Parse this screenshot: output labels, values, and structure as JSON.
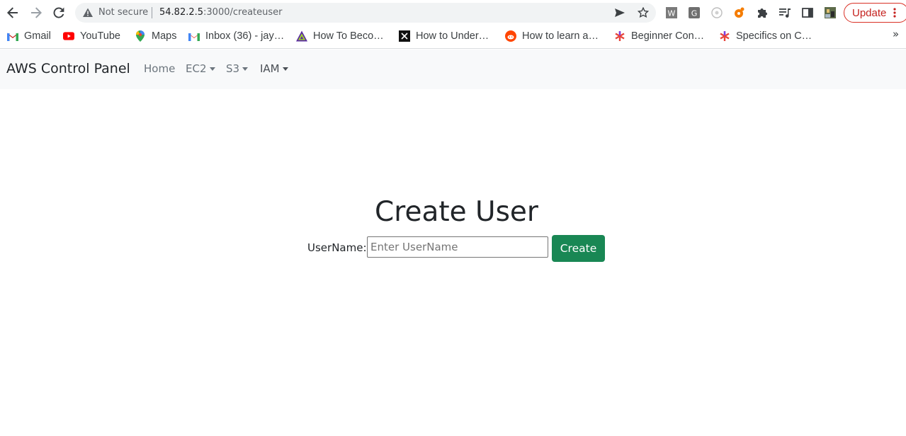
{
  "browser": {
    "security_label": "Not secure",
    "url_host": "54.82.2.5",
    "url_path": ":3000/createuser",
    "update_label": "Update",
    "accent_color": "#d93025",
    "icons": [
      "back-icon",
      "forward-icon",
      "reload-icon",
      "warning-icon",
      "send-icon",
      "star-icon",
      "extension-w-icon",
      "extension-g-icon",
      "extension-circle-icon",
      "extension-orange-icon",
      "puzzle-icon",
      "media-icon",
      "sidepanel-icon",
      "profile-icon",
      "more-icon"
    ]
  },
  "bookmarks": {
    "items": [
      {
        "label": "Gmail",
        "icon": "gmail-icon"
      },
      {
        "label": "YouTube",
        "icon": "youtube-icon"
      },
      {
        "label": "Maps",
        "icon": "maps-icon"
      },
      {
        "label": "Inbox (36) - jay…",
        "icon": "gmail-icon"
      },
      {
        "label": "How To Beco…",
        "icon": "triangle-icon"
      },
      {
        "label": "How to Under…",
        "icon": "square-logo-icon"
      },
      {
        "label": "How to learn a…",
        "icon": "reddit-icon"
      },
      {
        "label": "Beginner Con…",
        "icon": "asterisk-icon"
      },
      {
        "label": "Specifics on C…",
        "icon": "asterisk-icon"
      }
    ],
    "more": "»"
  },
  "navbar": {
    "brand": "AWS Control Panel",
    "links": [
      {
        "label": "Home",
        "dropdown": false
      },
      {
        "label": "EC2",
        "dropdown": true
      },
      {
        "label": "S3",
        "dropdown": true
      },
      {
        "label": "IAM",
        "dropdown": true
      }
    ],
    "background": "#f8f9fa"
  },
  "form": {
    "title": "Create User",
    "label": "UserName:",
    "input_value": "",
    "input_placeholder": "Enter UserName",
    "submit_label": "Create",
    "submit_color": "#198754"
  }
}
